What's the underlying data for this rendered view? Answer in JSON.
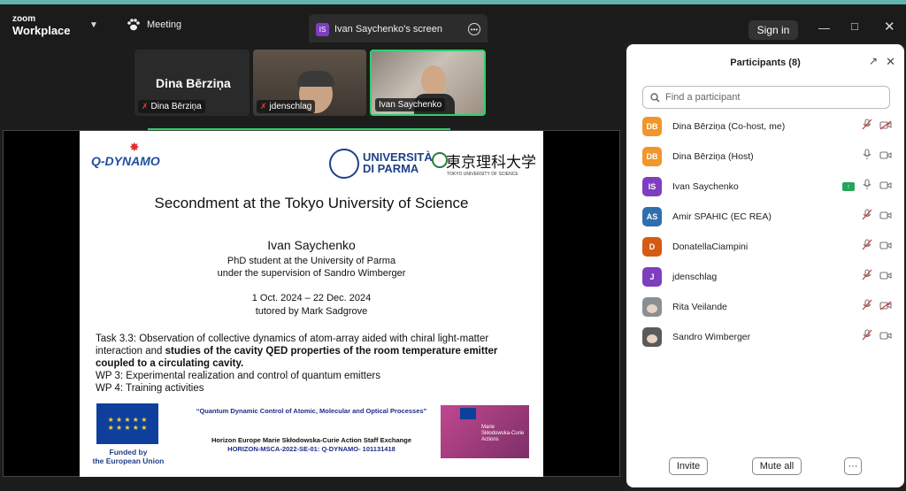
{
  "app": {
    "brand_top": "zoom",
    "brand_bottom": "Workplace"
  },
  "topbar": {
    "meeting_label": "Meeting",
    "screen_tab_badge": "IS",
    "screen_tab_label": "Ivan Saychenko's screen",
    "signin_label": "Sign in"
  },
  "video_tiles": [
    {
      "name": "Dina Bērziņa",
      "display_name": "Dina Bērziņa",
      "muted": true
    },
    {
      "name": "jdenschlag",
      "muted": true
    },
    {
      "name": "Ivan Saychenko",
      "muted": false,
      "active_speaker": true
    }
  ],
  "slide": {
    "logo_left": "Q-DYNAMO",
    "univ_parma_line1": "UNIVERSITÀ",
    "univ_parma_line2": "DI PARMA",
    "tus_name": "東京理科大学",
    "tus_sub": "TOKYO UNIVERSITY OF SCIENCE",
    "title": "Secondment at the Tokyo University of Science",
    "presenter": "Ivan Saychenko",
    "role1": "PhD student at the University of Parma",
    "role2": "under the supervision of Sandro Wimberger",
    "dates": "1 Oct. 2024 – 22 Dec. 2024",
    "tutor": "tutored by Mark Sadgrove",
    "task_prefix": "Task 3.3: Observation of collective dynamics of atom-array aided with chiral light-matter interaction and ",
    "task_bold": "studies of the cavity QED properties of the room temperature emitter coupled to a circulating cavity.",
    "wp3": "WP 3: Experimental realization and control of quantum emitters",
    "wp4": "WP 4: Training activities",
    "eu_funded_1": "Funded by",
    "eu_funded_2": "the European Union",
    "project_title": "“Quantum Dynamic Control of Atomic, Molecular and Optical Processes”",
    "horizon_line": "Horizon Europe Marie Skłodowska-Curie Action Staff Exchange",
    "grant_line": "HORIZON-MSCA-2022-SE-01: Q-DYNAMO- 101131418",
    "msca_text_1": "Marie",
    "msca_text_2": "Skłodowska-Curie",
    "msca_text_3": "Actions"
  },
  "panel": {
    "title": "Participants (8)",
    "search_placeholder": "Find a participant",
    "participants": [
      {
        "initials": "DB",
        "name": "Dina Bērziņa (Co-host, me)",
        "color": "#f0962b",
        "mic_muted": true,
        "video_off": true
      },
      {
        "initials": "DB",
        "name": "Dina Bērziņa (Host)",
        "color": "#f0962b",
        "mic_muted": false,
        "video_off": false
      },
      {
        "initials": "IS",
        "name": "Ivan Saychenko",
        "color": "#7d3fbf",
        "mic_muted": false,
        "video_off": false,
        "sharing": true
      },
      {
        "initials": "AS",
        "name": "Amir SPAHIC (EC REA)",
        "color": "#2e6fae",
        "mic_muted": true,
        "video_off": false
      },
      {
        "initials": "D",
        "name": "DonatellaCiampini",
        "color": "#d65a14",
        "mic_muted": true,
        "video_off": false
      },
      {
        "initials": "J",
        "name": "jdenschlag",
        "color": "#7d3fbf",
        "mic_muted": true,
        "video_off": false
      },
      {
        "initials": "",
        "name": "Rita Veilande",
        "color": "#8a8f95",
        "mic_muted": true,
        "video_off": true
      },
      {
        "initials": "",
        "name": "Sandro Wimberger",
        "color": "#5a5a5a",
        "mic_muted": true,
        "video_off": false
      }
    ],
    "invite_label": "Invite",
    "mute_all_label": "Mute all",
    "more_label": "···"
  }
}
